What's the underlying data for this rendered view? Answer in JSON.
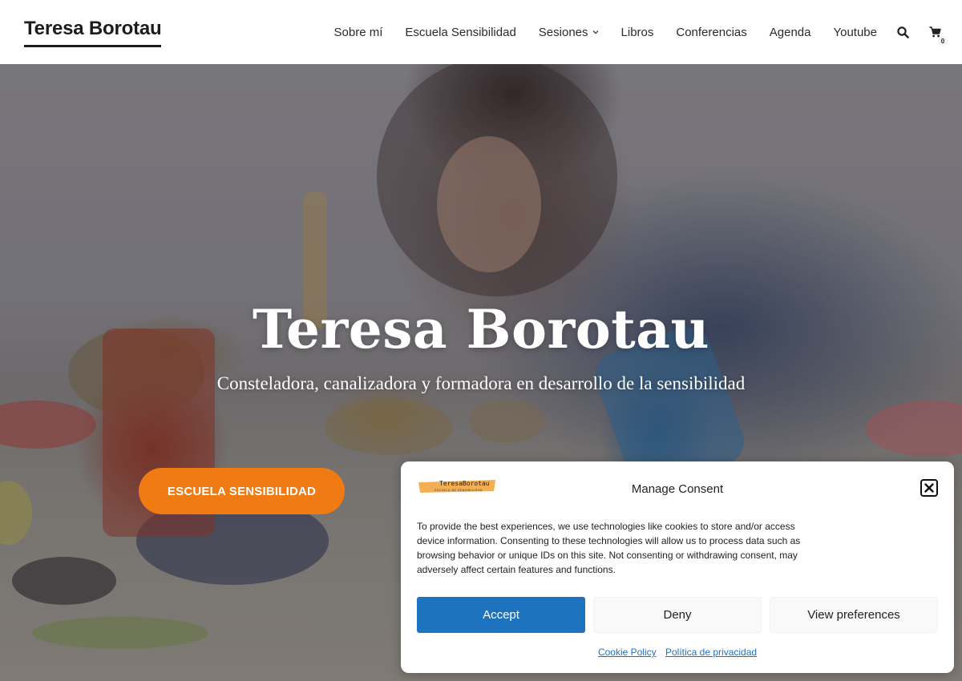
{
  "header": {
    "site_title": "Teresa Borotau",
    "nav": [
      {
        "label": "Sobre mí"
      },
      {
        "label": "Escuela Sensibilidad"
      },
      {
        "label": "Sesiones"
      },
      {
        "label": "Libros"
      },
      {
        "label": "Conferencias"
      },
      {
        "label": "Agenda"
      },
      {
        "label": "Youtube"
      }
    ],
    "search_icon": "search-icon",
    "cart_icon": "cart-icon",
    "cart_count": "0"
  },
  "hero": {
    "title": "Teresa Borotau",
    "subtitle": "Consteladora, canalizadora y formadora en desarrollo de la sensibilidad",
    "button_label": "ESCUELA SENSIBILIDAD",
    "button_color": "#ef7b12"
  },
  "consent": {
    "logo_text": "TeresaBorotau",
    "logo_subtext": "ESCUELA DE SENSIBILIDAD",
    "title": "Manage Consent",
    "body": "To provide the best experiences, we use technologies like cookies to store and/or access device information. Consenting to these technologies will allow us to process data such as browsing behavior or unique IDs on this site. Not consenting or withdrawing consent, may adversely affect certain features and functions.",
    "accept_label": "Accept",
    "deny_label": "Deny",
    "preferences_label": "View preferences",
    "links": [
      {
        "label": "Cookie Policy"
      },
      {
        "label": "Política de privacidad"
      }
    ],
    "accent_color": "#1e73be"
  }
}
